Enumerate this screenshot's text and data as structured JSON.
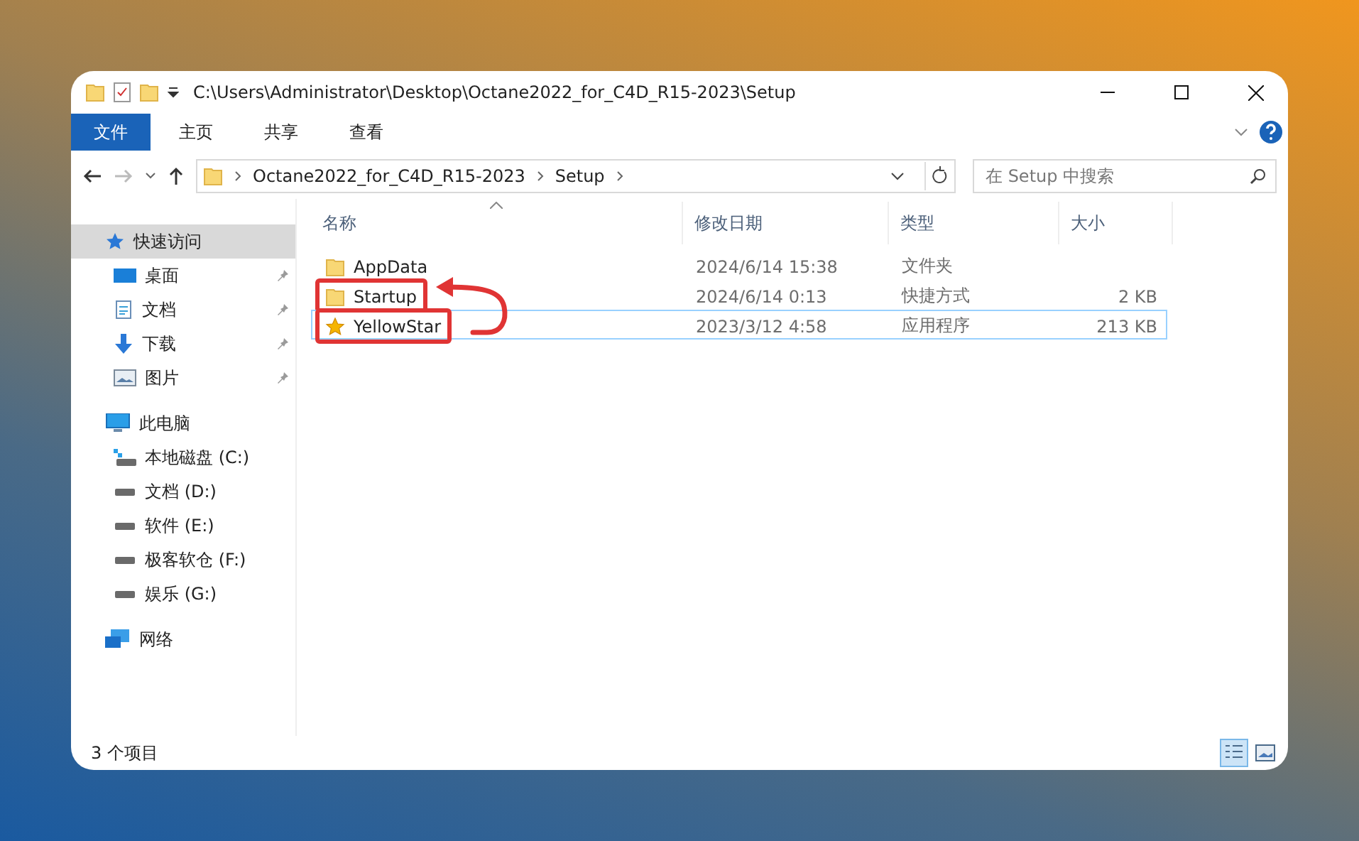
{
  "window": {
    "title": "C:\\Users\\Administrator\\Desktop\\Octane2022_for_C4D_R15-2023\\Setup"
  },
  "ribbon_tabs": [
    {
      "label": "文件",
      "selected": true
    },
    {
      "label": "主页",
      "selected": false
    },
    {
      "label": "共享",
      "selected": false
    },
    {
      "label": "查看",
      "selected": false
    }
  ],
  "address": {
    "segments": [
      "Octane2022_for_C4D_R15-2023",
      "Setup"
    ]
  },
  "search": {
    "placeholder": "在 Setup 中搜索"
  },
  "sidebar": {
    "items": [
      {
        "label": "快速访问",
        "kind": "star",
        "selected": true,
        "children": [
          {
            "label": "桌面",
            "kind": "desktop",
            "pinned": true,
            "selected": false
          },
          {
            "label": "文档",
            "kind": "document",
            "pinned": true,
            "selected": false
          },
          {
            "label": "下载",
            "kind": "download",
            "pinned": true,
            "selected": false
          },
          {
            "label": "图片",
            "kind": "picture",
            "pinned": true,
            "selected": false
          }
        ]
      },
      {
        "label": "此电脑",
        "kind": "computer",
        "selected": false,
        "children": [
          {
            "label": "本地磁盘 (C:)",
            "kind": "system-drive",
            "pinned": false,
            "selected": false
          },
          {
            "label": "文档 (D:)",
            "kind": "drive",
            "pinned": false,
            "selected": false
          },
          {
            "label": "软件 (E:)",
            "kind": "drive",
            "pinned": false,
            "selected": false
          },
          {
            "label": "极客软仓 (F:)",
            "kind": "drive",
            "pinned": false,
            "selected": false
          },
          {
            "label": "娱乐 (G:)",
            "kind": "drive",
            "pinned": false,
            "selected": false
          }
        ]
      },
      {
        "label": "网络",
        "kind": "network",
        "selected": false
      }
    ]
  },
  "table": {
    "columns": [
      "名称",
      "修改日期",
      "类型",
      "大小"
    ],
    "rows": [
      {
        "kind": "folder",
        "name": "AppData",
        "date": "2024/6/14 15:38",
        "type": "文件夹",
        "selected": false,
        "highlighted": false
      },
      {
        "kind": "folder",
        "name": "Startup",
        "date": "2024/6/14 0:13",
        "type": "快捷方式",
        "size": "2 KB",
        "selected": false,
        "highlighted": true
      },
      {
        "kind": "star",
        "name": "YellowStar",
        "date": "2023/3/12 4:58",
        "type": "应用程序",
        "size": "213 KB",
        "selected": true,
        "highlighted": true
      }
    ]
  },
  "status_bar": {
    "count": "3 个项目",
    "view_buttons": [
      {
        "kind": "details",
        "selected": true
      },
      {
        "kind": "thumbnails",
        "selected": false
      }
    ]
  }
}
